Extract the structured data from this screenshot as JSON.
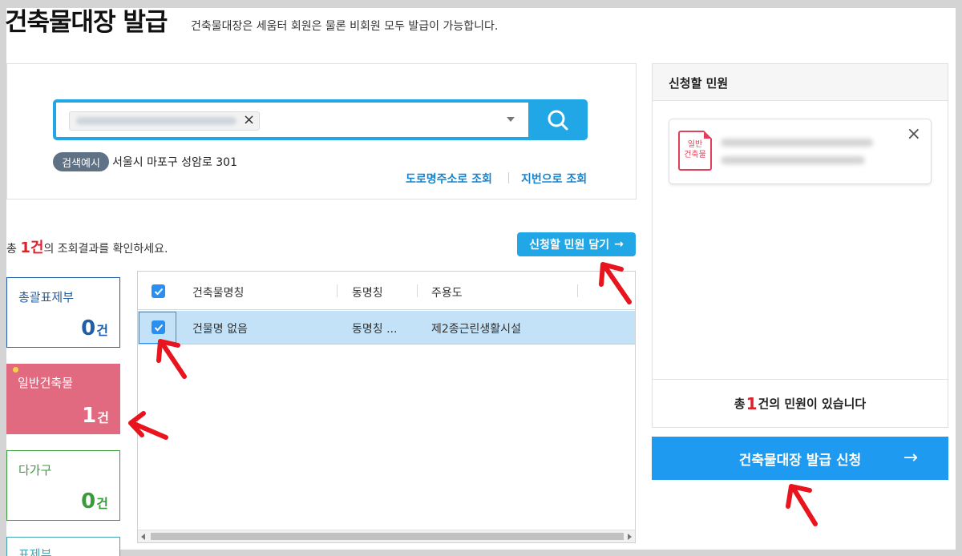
{
  "header": {
    "title": "건축물대장 발급",
    "description": "건축물대장은 세움터 회원은 물론 비회원 모두 발급이 가능합니다."
  },
  "search": {
    "chip_close": "×",
    "example_badge": "검색예시",
    "example_text": "서울시 마포구 성암로 301",
    "link_road": "도로명주소로 조회",
    "link_jibun": "지번으로 조회"
  },
  "results": {
    "prefix": "총 ",
    "count": "1건",
    "suffix": "의 조회결과를 확인하세요.",
    "add_button": "신청할 민원 담기",
    "add_button_arrow": "→"
  },
  "categories": [
    {
      "label": "총괄표제부",
      "count": "0",
      "unit": "건"
    },
    {
      "label": "일반건축물",
      "count": "1",
      "unit": "건"
    },
    {
      "label": "다가구",
      "count": "0",
      "unit": "건"
    },
    {
      "label": "표제부"
    }
  ],
  "grid": {
    "columns": [
      "건축물명칭",
      "동명칭",
      "주용도"
    ],
    "rows": [
      {
        "name": "건물명 없음",
        "dong": "동명칭 ...",
        "use": "제2종근린생활시설",
        "checked": true
      }
    ]
  },
  "side": {
    "title": "신청할 민원",
    "card_icon_line1": "일반",
    "card_icon_line2": "건축물",
    "card_close": "×",
    "summary_prefix": "총 ",
    "summary_count": "1",
    "summary_suffix": "건의 민원이 있습니다",
    "issue_button": "건축물대장 발급 신청",
    "issue_arrow": "→"
  },
  "colors": {
    "accent": "#22a7e6",
    "issue_button": "#1e9af0",
    "general_building": "#e16a80",
    "annotation_arrow": "#e8141e"
  }
}
